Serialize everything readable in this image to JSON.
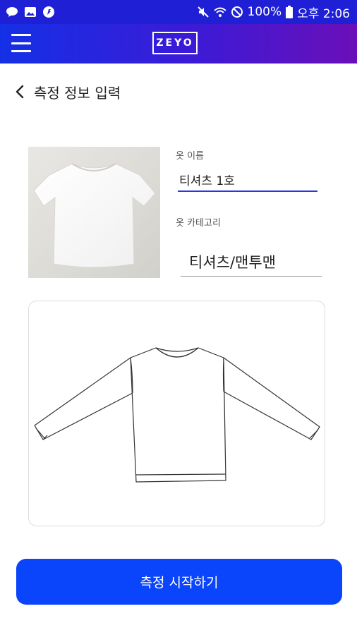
{
  "status_bar": {
    "battery": "100%",
    "time": "오후 2:06",
    "left_icons": [
      "message-icon",
      "gallery-icon",
      "app-notification-icon"
    ],
    "right_icons": [
      "mute-icon",
      "wifi-icon",
      "do-not-disturb-icon",
      "battery-icon"
    ]
  },
  "app_bar": {
    "logo": "ZEYO",
    "gradient_colors": [
      "#1430e6",
      "#6a0fb8"
    ]
  },
  "header": {
    "title": "측정 정보 입력"
  },
  "form": {
    "name_label": "옷 이름",
    "name_value": "티셔츠 1호",
    "category_label": "옷 카테고리",
    "category_value": "티셔츠/맨투맨"
  },
  "actions": {
    "start_label": "측정 시작하기",
    "accent_color": "#0a44fb"
  }
}
